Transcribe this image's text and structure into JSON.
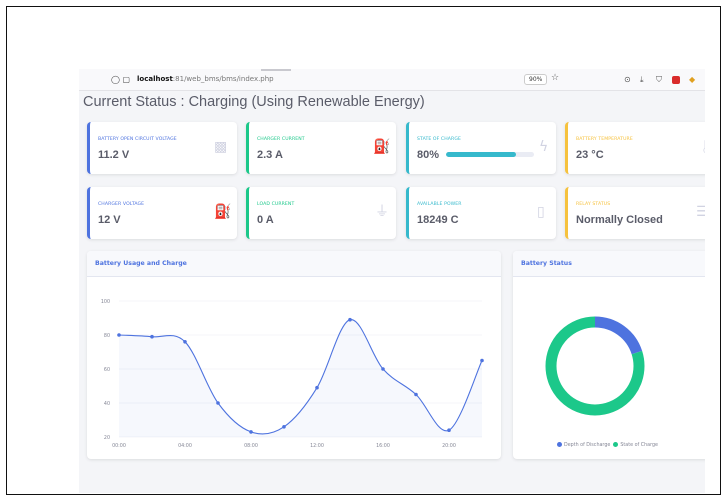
{
  "browser": {
    "url_host": "localhost",
    "url_rest": ":81/web_bms/bms/index.php",
    "zoom": "90%"
  },
  "page_title": "Current Status : Charging (Using Renewable Energy)",
  "cards": [
    {
      "label": "Battery Open Circuit Voltage",
      "value": "11.2 V",
      "accent": "#4e73df",
      "icon": "car-battery-icon"
    },
    {
      "label": "Charger Current",
      "value": "2.3 A",
      "accent": "#1cc88a",
      "icon": "charging-station-icon"
    },
    {
      "label": "State of Charge",
      "value": "80%",
      "accent": "#36b9cc",
      "icon": "bolt-icon",
      "progress": 0.8
    },
    {
      "label": "Battery Temperature",
      "value": "23 °C",
      "accent": "#f6c23e",
      "icon": "thermometer-icon"
    },
    {
      "label": "Charger Voltage",
      "value": "12 V",
      "accent": "#4e73df",
      "icon": "charging-station-icon"
    },
    {
      "label": "Load Current",
      "value": "0 A",
      "accent": "#1cc88a",
      "icon": "plug-icon"
    },
    {
      "label": "Available Power",
      "value": "18249 C",
      "accent": "#36b9cc",
      "icon": "battery-icon"
    },
    {
      "label": "Relay Status",
      "value": "Normally Closed",
      "accent": "#f6c23e",
      "icon": "server-icon"
    }
  ],
  "panels": {
    "usage_title": "Battery Usage and Charge",
    "status_title": "Battery Status"
  },
  "chart_data": [
    {
      "type": "area",
      "title": "Battery Usage and Charge",
      "x": [
        "00:00",
        "02:00",
        "04:00",
        "06:00",
        "08:00",
        "10:00",
        "12:00",
        "14:00",
        "16:00",
        "18:00",
        "20:00",
        "22:00"
      ],
      "xticks": [
        "00:00",
        "04:00",
        "08:00",
        "12:00",
        "16:00",
        "20:00"
      ],
      "values": [
        80,
        79,
        76,
        40,
        23,
        26,
        49,
        89,
        60,
        45,
        24,
        65
      ],
      "ylim": [
        20,
        100
      ],
      "yticks": [
        20,
        40,
        60,
        80,
        100
      ],
      "grid": true,
      "color": "#4e73df"
    },
    {
      "type": "pie",
      "title": "Battery Status",
      "labels": [
        "Depth of Discharge",
        "State of Charge"
      ],
      "values": [
        20,
        80
      ],
      "colors": [
        "#4e73df",
        "#1cc88a"
      ],
      "legend": "bottom"
    }
  ]
}
